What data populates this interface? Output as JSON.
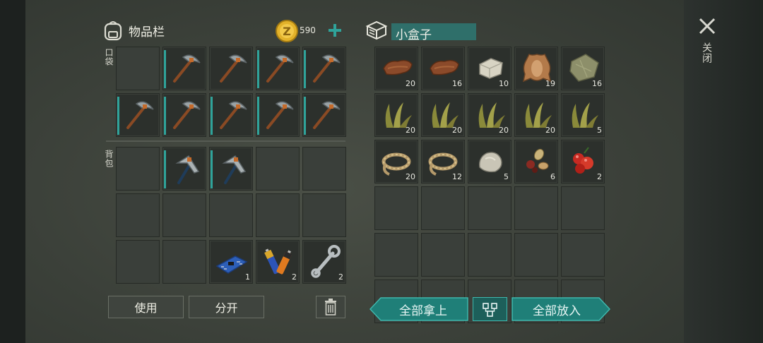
{
  "inventory": {
    "title": "物品栏",
    "coins": "590",
    "pocket_label": "口袋",
    "backpack_label": "背包"
  },
  "container": {
    "title": "小盒子"
  },
  "close_label": "关闭",
  "pocket_slots": [
    {
      "icon": "empty",
      "count": ""
    },
    {
      "icon": "pickaxe-icon",
      "count": "",
      "bar": 1
    },
    {
      "icon": "pickaxe-icon",
      "count": ""
    },
    {
      "icon": "pickaxe-icon",
      "count": "",
      "bar": 1
    },
    {
      "icon": "pickaxe-icon",
      "count": "",
      "bar": 1
    },
    {
      "icon": "pickaxe-icon",
      "count": "",
      "bar": 1
    },
    {
      "icon": "pickaxe-icon",
      "count": "",
      "bar": 1
    },
    {
      "icon": "pickaxe-icon",
      "count": "",
      "bar": 1
    },
    {
      "icon": "pickaxe-icon",
      "count": "",
      "bar": 1
    },
    {
      "icon": "pickaxe-icon",
      "count": "",
      "bar": 1
    }
  ],
  "backpack_slots": [
    {
      "icon": "empty",
      "count": ""
    },
    {
      "icon": "hatchet-icon",
      "count": "",
      "bar": 1
    },
    {
      "icon": "hatchet-icon",
      "count": "",
      "bar": 1
    },
    {
      "icon": "empty",
      "count": ""
    },
    {
      "icon": "empty",
      "count": ""
    },
    {
      "icon": "empty",
      "count": ""
    },
    {
      "icon": "empty",
      "count": ""
    },
    {
      "icon": "empty",
      "count": ""
    },
    {
      "icon": "empty",
      "count": ""
    },
    {
      "icon": "empty",
      "count": ""
    },
    {
      "icon": "empty",
      "count": ""
    },
    {
      "icon": "empty",
      "count": ""
    },
    {
      "icon": "circuit-board-icon",
      "count": "1"
    },
    {
      "icon": "batteries-icon",
      "count": "2"
    },
    {
      "icon": "wrench-icon",
      "count": "2"
    }
  ],
  "box_slots": [
    {
      "icon": "leather-icon",
      "count": "20"
    },
    {
      "icon": "leather-icon",
      "count": "16"
    },
    {
      "icon": "stone-block-icon",
      "count": "10"
    },
    {
      "icon": "hide-icon",
      "count": "19"
    },
    {
      "icon": "cloth-icon",
      "count": "16"
    },
    {
      "icon": "grass-icon",
      "count": "20"
    },
    {
      "icon": "grass-icon",
      "count": "20"
    },
    {
      "icon": "grass-icon",
      "count": "20"
    },
    {
      "icon": "grass-icon",
      "count": "20"
    },
    {
      "icon": "grass-icon",
      "count": "5"
    },
    {
      "icon": "rope-icon",
      "count": "20"
    },
    {
      "icon": "rope-icon",
      "count": "12"
    },
    {
      "icon": "rock-icon",
      "count": "5"
    },
    {
      "icon": "seeds-icon",
      "count": "6"
    },
    {
      "icon": "berries-icon",
      "count": "2"
    },
    {
      "icon": "empty",
      "count": ""
    },
    {
      "icon": "empty",
      "count": ""
    },
    {
      "icon": "empty",
      "count": ""
    },
    {
      "icon": "empty",
      "count": ""
    },
    {
      "icon": "empty",
      "count": ""
    },
    {
      "icon": "empty",
      "count": ""
    },
    {
      "icon": "empty",
      "count": ""
    },
    {
      "icon": "empty",
      "count": ""
    },
    {
      "icon": "empty",
      "count": ""
    },
    {
      "icon": "empty",
      "count": ""
    },
    {
      "icon": "empty",
      "count": ""
    },
    {
      "icon": "empty",
      "count": ""
    },
    {
      "icon": "empty",
      "count": ""
    },
    {
      "icon": "empty",
      "count": ""
    },
    {
      "icon": "empty",
      "count": ""
    }
  ],
  "buttons": {
    "use": "使用",
    "split": "分开",
    "take_all": "全部拿上",
    "put_all": "全部放入"
  },
  "colors": {
    "accent": "#2fa39a",
    "button_teal": "#1f7f78",
    "title_field": "#2f6f6a",
    "coin": "#e3b22a"
  }
}
